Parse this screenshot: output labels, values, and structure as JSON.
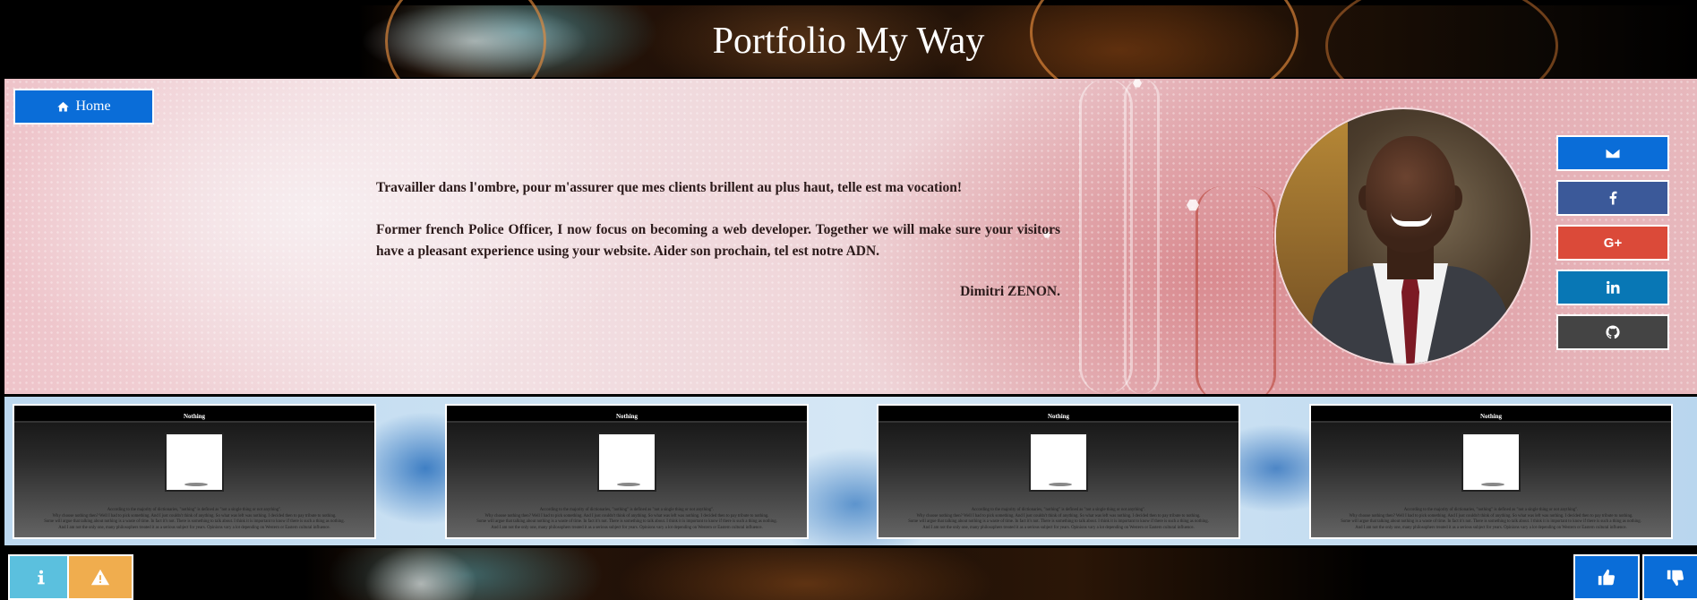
{
  "header": {
    "title": "Portfolio My Way"
  },
  "nav": {
    "home_label": "Home",
    "home_icon": "home-icon"
  },
  "intro": {
    "tagline": "Travailler dans l'ombre, pour m'assurer que mes clients brillent au plus haut, telle est ma vocation!",
    "bio": "Former french Police Officer, I now focus on becoming a web developer. Together we will make sure your visitors have a pleasant experience using your website. Aider son prochain, tel est notre ADN.",
    "signature": "Dimitri ZENON."
  },
  "social": [
    {
      "name": "email",
      "icon": "envelope-icon",
      "color": "#0a6dd8"
    },
    {
      "name": "facebook",
      "icon": "facebook-icon",
      "color": "#3b5999"
    },
    {
      "name": "google-plus",
      "icon": "google-plus-icon",
      "label": "G+",
      "color": "#db4a39"
    },
    {
      "name": "linkedin",
      "icon": "linkedin-icon",
      "color": "#0877b5"
    },
    {
      "name": "github",
      "icon": "github-icon",
      "color": "#444444"
    }
  ],
  "projects": [
    {
      "title": "Nothing",
      "text1": "According to the majority of dictionaries, \"nothing\" is defined as \"not a single thing or not anything\".",
      "text2": "Why choose nothing then? Well I had to pick something. And I just couldn't think of anything. So what was left was nothing. I decided then to pay tribute to nothing.",
      "text3": "Some will argue that talking about nothing is a waste of time. In fact it's not. There is something to talk about. I think it is important to know if there is such a thing as nothing.",
      "text4": "And I am not the only one, many philosophers treated it as a serious subject for years. Opinions vary a lot depending on Western or Eastern cultural influence."
    },
    {
      "title": "Nothing",
      "text1": "According to the majority of dictionaries, \"nothing\" is defined as \"not a single thing or not anything\".",
      "text2": "Why choose nothing then? Well I had to pick something. And I just couldn't think of anything. So what was left was nothing. I decided then to pay tribute to nothing.",
      "text3": "Some will argue that talking about nothing is a waste of time. In fact it's not. There is something to talk about. I think it is important to know if there is such a thing as nothing.",
      "text4": "And I am not the only one, many philosophers treated it as a serious subject for years. Opinions vary a lot depending on Western or Eastern cultural influence."
    },
    {
      "title": "Nothing",
      "text1": "According to the majority of dictionaries, \"nothing\" is defined as \"not a single thing or not anything\".",
      "text2": "Why choose nothing then? Well I had to pick something. And I just couldn't think of anything. So what was left was nothing. I decided then to pay tribute to nothing.",
      "text3": "Some will argue that talking about nothing is a waste of time. In fact it's not. There is something to talk about. I think it is important to know if there is such a thing as nothing.",
      "text4": "And I am not the only one, many philosophers treated it as a serious subject for years. Opinions vary a lot depending on Western or Eastern cultural influence."
    },
    {
      "title": "Nothing",
      "text1": "According to the majority of dictionaries, \"nothing\" is defined as \"not a single thing or not anything\".",
      "text2": "Why choose nothing then? Well I had to pick something. And I just couldn't think of anything. So what was left was nothing. I decided then to pay tribute to nothing.",
      "text3": "Some will argue that talking about nothing is a waste of time. In fact it's not. There is something to talk about. I think it is important to know if there is such a thing as nothing.",
      "text4": "And I am not the only one, many philosophers treated it as a serious subject for years. Opinions vary a lot depending on Western or Eastern cultural influence."
    }
  ],
  "footer": {
    "info_icon": "info-icon",
    "warning_icon": "warning-icon",
    "like_icon": "thumbs-up-icon",
    "dislike_icon": "thumbs-down-icon"
  }
}
